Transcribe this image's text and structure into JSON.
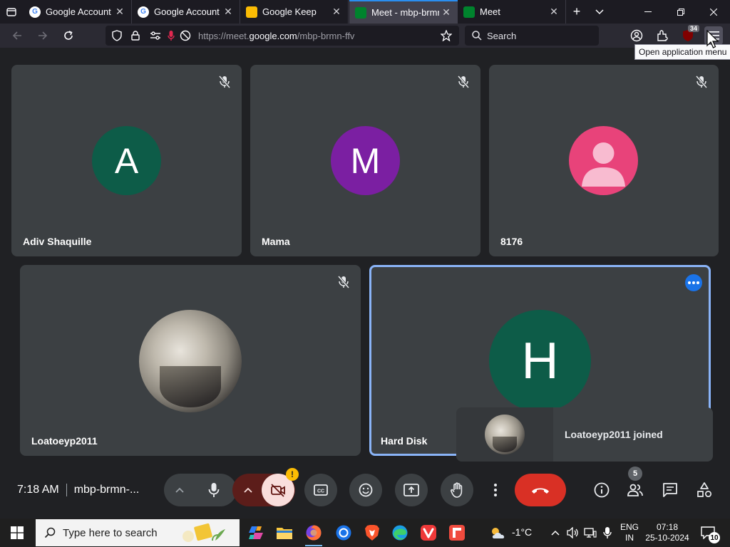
{
  "browser": {
    "tabs": [
      {
        "title": "Google Account",
        "favicon": "google-icon",
        "active": false
      },
      {
        "title": "Google Account",
        "favicon": "google-icon",
        "active": false
      },
      {
        "title": "Google Keep",
        "favicon": "keep-icon",
        "active": false
      },
      {
        "title": "Meet - mbp-brmn",
        "favicon": "meet-icon",
        "active": true,
        "playing_audio": true
      },
      {
        "title": "Meet",
        "favicon": "meet-icon",
        "active": false
      }
    ],
    "url_prefix": "https://meet.",
    "url_host": "google.com",
    "url_path": "/mbp-brmn-ffv",
    "search_placeholder": "Search",
    "extension_badge": "34",
    "tooltip": "Open application menu"
  },
  "meet": {
    "participants": [
      {
        "name": "Adiv Shaquille",
        "initial": "A",
        "avatar_color": "#0d5c48",
        "muted": true
      },
      {
        "name": "Mama",
        "initial": "M",
        "avatar_color": "#7b1fa2",
        "muted": true
      },
      {
        "name": "8176",
        "initial": "",
        "avatar_color": "#e8437a",
        "muted": true,
        "avatar_type": "default-person"
      },
      {
        "name": "Loatoeyp2011",
        "initial": "",
        "avatar_type": "photo",
        "muted": true
      },
      {
        "name": "Hard Disk",
        "initial": "H",
        "avatar_color": "#0d5c48",
        "muted": false,
        "speaking": true
      }
    ],
    "toast": {
      "message": "Loatoeyp2011 joined"
    },
    "time": "7:18 AM",
    "meeting_code": "mbp-brmn-...",
    "people_count": "5",
    "camera_warning": "!"
  },
  "taskbar": {
    "search_placeholder": "Type here to search",
    "weather_temp": "-1°C",
    "lang_line1": "ENG",
    "lang_line2": "IN",
    "clock_time": "07:18",
    "clock_date": "25-10-2024",
    "notification_count": "10"
  },
  "colors": {
    "accent": "#8ab4f8",
    "end_call": "#d93025",
    "tile_bg": "#3c4043",
    "stage_bg": "#202124"
  }
}
